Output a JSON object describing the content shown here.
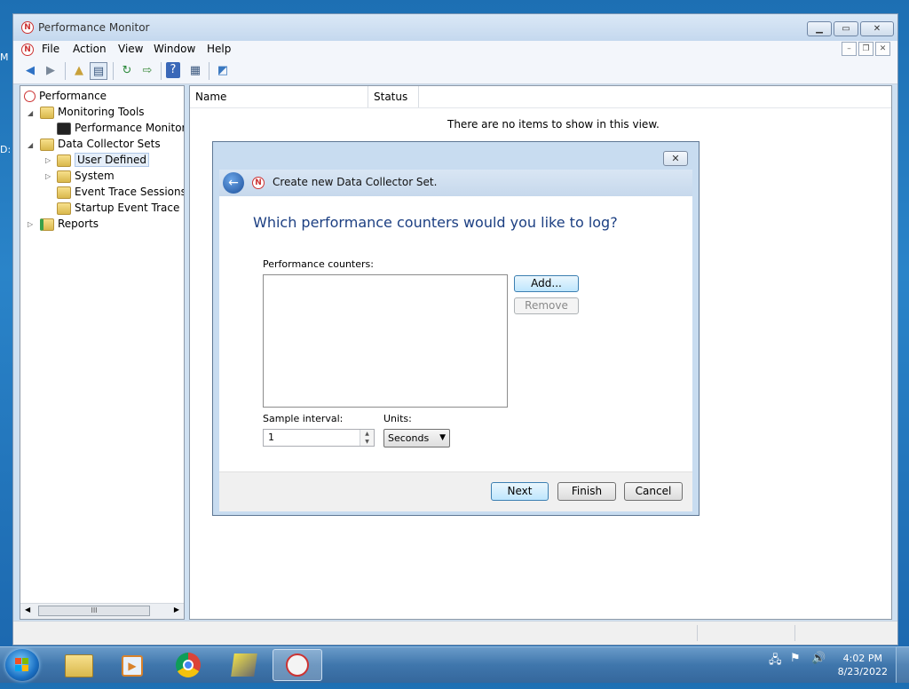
{
  "desktop": {
    "left_labels": [
      "M",
      "D:"
    ]
  },
  "window": {
    "title": "Performance Monitor",
    "menu": [
      "File",
      "Action",
      "View",
      "Window",
      "Help"
    ]
  },
  "tree": {
    "items": [
      {
        "label": "Performance"
      },
      {
        "label": "Monitoring Tools"
      },
      {
        "label": "Performance Monitor"
      },
      {
        "label": "Data Collector Sets"
      },
      {
        "label": "User Defined"
      },
      {
        "label": "System"
      },
      {
        "label": "Event Trace Sessions"
      },
      {
        "label": "Startup Event Trace Ses"
      },
      {
        "label": "Reports"
      }
    ]
  },
  "list": {
    "columns": [
      "Name",
      "Status"
    ],
    "empty_message": "There are no items to show in this view."
  },
  "dialog": {
    "title": "Create new Data Collector Set.",
    "question": "Which performance counters would you like to log?",
    "counters_label": "Performance counters:",
    "add_label": "Add...",
    "remove_label": "Remove",
    "sample_interval_label": "Sample interval:",
    "sample_interval_value": "1",
    "units_label": "Units:",
    "units_value": "Seconds",
    "next_label": "Next",
    "finish_label": "Finish",
    "cancel_label": "Cancel"
  },
  "taskbar": {
    "time": "4:02 PM",
    "date": "8/23/2022"
  },
  "colors": {
    "accent": "#1c3f82",
    "desktop": "#2a84c9",
    "dialog_frame": "#c8dcf0"
  }
}
